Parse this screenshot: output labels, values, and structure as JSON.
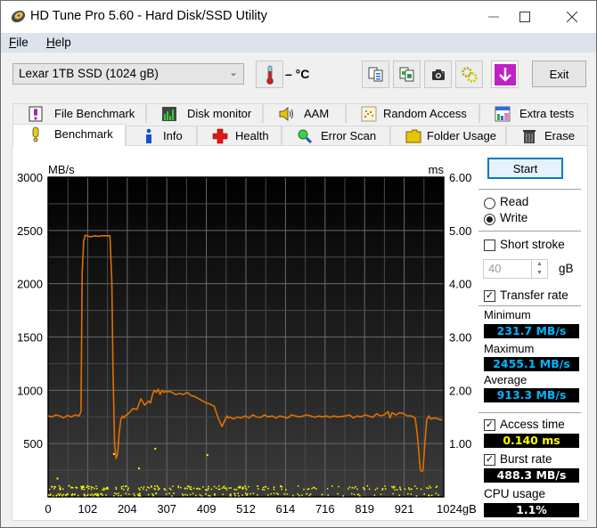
{
  "window": {
    "title": "HD Tune Pro 5.60 - Hard Disk/SSD Utility",
    "controls": [
      "minimize",
      "maximize",
      "close"
    ]
  },
  "menu": [
    {
      "label": "File",
      "accel": "F"
    },
    {
      "label": "Help",
      "accel": "H"
    }
  ],
  "toolbar": {
    "drive_select": "Lexar 1TB SSD (1024 gB)",
    "temperature": "– °C",
    "icons": [
      "copy-info-icon",
      "copy-screen-icon",
      "screenshot-camera-icon",
      "options-gear-icon",
      "save-down-arrow-icon"
    ],
    "exit_label": "Exit"
  },
  "tabs_top": [
    {
      "label": "File Benchmark",
      "icon": "file-benchmark-icon"
    },
    {
      "label": "Disk monitor",
      "icon": "disk-monitor-icon"
    },
    {
      "label": "AAM",
      "icon": "speaker-icon"
    },
    {
      "label": "Random Access",
      "icon": "random-access-icon"
    },
    {
      "label": "Extra tests",
      "icon": "extra-tests-icon"
    }
  ],
  "tabs_bottom": [
    {
      "label": "Benchmark",
      "icon": "exclamation-bulb-icon",
      "active": true
    },
    {
      "label": "Info",
      "icon": "info-icon"
    },
    {
      "label": "Health",
      "icon": "health-cross-icon"
    },
    {
      "label": "Error Scan",
      "icon": "magnifier-icon"
    },
    {
      "label": "Folder Usage",
      "icon": "folder-icon"
    },
    {
      "label": "Erase",
      "icon": "trash-icon"
    }
  ],
  "sidebar": {
    "start_label": "Start",
    "mode_options": [
      {
        "label": "Read",
        "selected": false
      },
      {
        "label": "Write",
        "selected": true
      }
    ],
    "short_stroke": {
      "label": "Short stroke",
      "checked": false,
      "value": "40",
      "unit": "gB"
    },
    "transfer_rate": {
      "label": "Transfer rate",
      "checked": true
    },
    "minimum": {
      "label": "Minimum",
      "value": "231.7 MB/s"
    },
    "maximum": {
      "label": "Maximum",
      "value": "2455.1 MB/s"
    },
    "average": {
      "label": "Average",
      "value": "913.3 MB/s"
    },
    "access_time": {
      "label": "Access time",
      "checked": true,
      "value": "0.140 ms"
    },
    "burst_rate": {
      "label": "Burst rate",
      "checked": true,
      "value": "488.3 MB/s"
    },
    "cpu_usage": {
      "label": "CPU usage",
      "value": "1.1%"
    },
    "colors": {
      "transfer": "#00b4ff",
      "access": "#ffff00",
      "white": "#ffffff"
    }
  },
  "chart_data": {
    "type": "line",
    "title": "",
    "ylabel": "MB/s",
    "y2label": "ms",
    "xlabel": "",
    "xlim": [
      0,
      1024
    ],
    "ylim": [
      0,
      3000
    ],
    "y2lim": [
      0,
      6
    ],
    "grid": true,
    "x_ticks": [
      "0",
      "102",
      "204",
      "307",
      "409",
      "512",
      "614",
      "716",
      "819",
      "921",
      "1024gB"
    ],
    "y_ticks": [
      "500",
      "1000",
      "1500",
      "2000",
      "2500",
      "3000"
    ],
    "y2_ticks": [
      "1.00",
      "2.00",
      "3.00",
      "4.00",
      "5.00",
      "6.00"
    ],
    "series": [
      {
        "name": "Transfer rate (MB/s)",
        "color": "#e07000",
        "x": [
          0,
          10,
          20,
          30,
          40,
          50,
          60,
          70,
          80,
          85,
          88,
          92,
          96,
          100,
          110,
          120,
          130,
          140,
          150,
          160,
          165,
          168,
          172,
          176,
          180,
          184,
          188,
          192,
          196,
          200,
          210,
          220,
          230,
          240,
          250,
          260,
          265,
          270,
          275,
          280,
          285,
          290,
          295,
          300,
          305,
          310,
          315,
          320,
          330,
          340,
          350,
          360,
          370,
          380,
          390,
          400,
          410,
          420,
          430,
          440,
          450,
          455,
          460,
          463,
          466,
          470,
          480,
          490,
          500,
          510,
          520,
          530,
          540,
          550,
          560,
          570,
          580,
          590,
          600,
          610,
          620,
          630,
          640,
          650,
          660,
          670,
          680,
          690,
          700,
          710,
          720,
          730,
          740,
          750,
          760,
          770,
          780,
          790,
          800,
          810,
          820,
          830,
          840,
          850,
          860,
          870,
          880,
          885,
          890,
          900,
          910,
          920,
          930,
          940,
          950,
          955,
          960,
          963,
          966,
          970,
          975,
          980,
          985,
          990,
          1000,
          1010,
          1020
        ],
        "values": [
          760,
          750,
          770,
          760,
          740,
          765,
          750,
          770,
          760,
          800,
          2100,
          2400,
          2455,
          2450,
          2440,
          2450,
          2445,
          2450,
          2450,
          2450,
          2020,
          1200,
          500,
          360,
          400,
          600,
          720,
          760,
          740,
          760,
          790,
          830,
          820,
          920,
          860,
          900,
          880,
          960,
          1000,
          980,
          1010,
          960,
          1000,
          980,
          990,
          985,
          990,
          980,
          960,
          970,
          960,
          980,
          950,
          940,
          920,
          900,
          880,
          870,
          850,
          740,
          660,
          700,
          740,
          760,
          740,
          750,
          730,
          750,
          740,
          760,
          740,
          770,
          750,
          745,
          770,
          750,
          760,
          740,
          760,
          750,
          740,
          770,
          760,
          750,
          760,
          770,
          760,
          745,
          760,
          750,
          760,
          745,
          760,
          750,
          755,
          760,
          770,
          740,
          760,
          750,
          770,
          760,
          745,
          780,
          760,
          770,
          800,
          740,
          790,
          770,
          790,
          780,
          760,
          760,
          740,
          600,
          400,
          260,
          240,
          245,
          500,
          720,
          760,
          730,
          740,
          730,
          720
        ]
      },
      {
        "name": "Access time (ms)",
        "color": "#ffff00",
        "type": "scatter",
        "note": "dense band of points roughly 0.05-0.20 ms across full range, a few outliers up to ~0.9 ms"
      }
    ]
  }
}
